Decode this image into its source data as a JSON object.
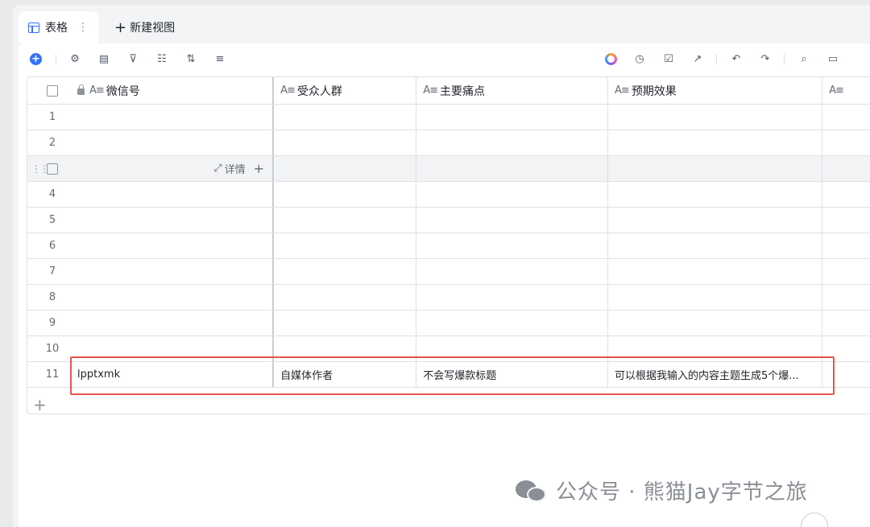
{
  "tabs": {
    "active_label": "表格",
    "more_glyph": "⋮",
    "new_view_label": "新建视图"
  },
  "toolbar": {
    "left_icons": [
      "add-record-icon",
      "settings-icon",
      "field-config-icon",
      "filter-icon",
      "group-icon",
      "sort-icon",
      "row-height-icon"
    ],
    "right_icons": [
      "ai-icon",
      "history-icon",
      "task-icon",
      "share-icon",
      "undo-icon",
      "redo-icon",
      "search-icon",
      "comment-icon"
    ]
  },
  "columns": [
    {
      "type_glyph": "A≡",
      "label": "微信号",
      "locked": true
    },
    {
      "type_glyph": "A≡",
      "label": "受众人群"
    },
    {
      "type_glyph": "A≡",
      "label": "主要痛点"
    },
    {
      "type_glyph": "A≡",
      "label": "预期效果"
    },
    {
      "type_glyph": "A≡",
      "label": ""
    }
  ],
  "hover_row": {
    "detail_label": "详情",
    "expand_glyph": "⤢",
    "add_glyph": "+"
  },
  "rows": [
    {
      "num": "1",
      "cells": [
        "",
        "",
        "",
        ""
      ]
    },
    {
      "num": "2",
      "cells": [
        "",
        "",
        "",
        ""
      ]
    },
    {
      "num": "",
      "cells": [
        "",
        "",
        "",
        ""
      ]
    },
    {
      "num": "4",
      "cells": [
        "",
        "",
        "",
        ""
      ]
    },
    {
      "num": "5",
      "cells": [
        "",
        "",
        "",
        ""
      ]
    },
    {
      "num": "6",
      "cells": [
        "",
        "",
        "",
        ""
      ]
    },
    {
      "num": "7",
      "cells": [
        "",
        "",
        "",
        ""
      ]
    },
    {
      "num": "8",
      "cells": [
        "",
        "",
        "",
        ""
      ]
    },
    {
      "num": "9",
      "cells": [
        "",
        "",
        "",
        ""
      ]
    },
    {
      "num": "10",
      "cells": [
        "",
        "",
        "",
        ""
      ]
    },
    {
      "num": "11",
      "cells": [
        "lpptxmk",
        "自媒体作者",
        "不会写爆款标题",
        "可以根据我输入的内容主题生成5个爆..."
      ]
    }
  ],
  "add_row_glyph": "+",
  "watermark": {
    "text": "公众号 · 熊猫Jay字节之旅"
  },
  "colors": {
    "accent": "#3370ff",
    "highlight": "#e8534b",
    "border": "#dee0e3"
  }
}
